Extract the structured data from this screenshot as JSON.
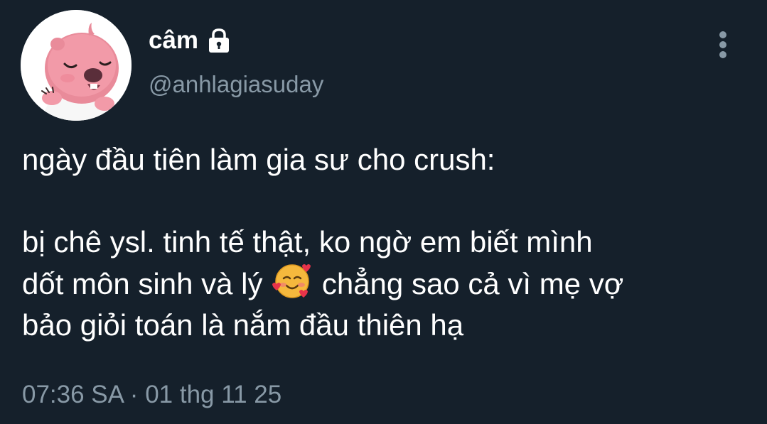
{
  "user": {
    "display_name": "câm",
    "handle": "@anhlagiasuday",
    "avatar_icon": "pink-beaver-avatar",
    "protected_icon": "lock-icon"
  },
  "menu": {
    "icon": "more-vertical-icon"
  },
  "tweet": {
    "line1": "ngày đầu tiên làm gia sư cho crush:",
    "line2": "bị chê ysl. tinh tế thật, ko ngờ em biết mình",
    "line3_before_emoji": "dốt môn sinh và lý ",
    "emoji": "smiling-face-with-hearts",
    "line3_after_emoji": " chẳng sao cả vì mẹ vợ",
    "line4": "bảo giỏi toán là nắm đầu thiên hạ"
  },
  "meta": {
    "time": "07:36 SA",
    "separator": " · ",
    "date": "01 thg 11 25"
  },
  "colors": {
    "background": "#15202b",
    "text": "#ffffff",
    "secondary_text": "#8899a6"
  }
}
